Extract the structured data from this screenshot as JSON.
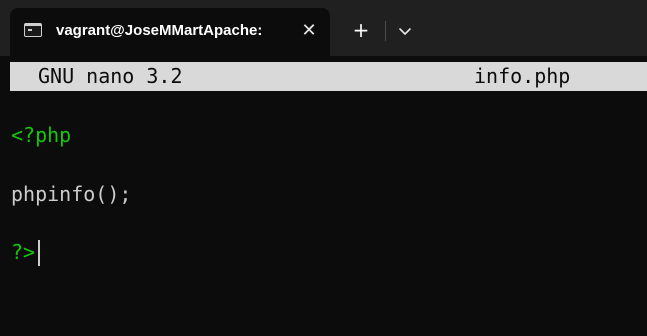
{
  "tab": {
    "title": "vagrant@JoseMMartApache: ",
    "icon": "terminal-icon",
    "close_icon": "close-icon"
  },
  "tabbar": {
    "new_tab_label": "+",
    "dropdown_icon": "chevron-down-icon"
  },
  "editor": {
    "name_version": "GNU nano 3.2",
    "filename": "info.php",
    "lines": [
      "<?php",
      "phpinfo();",
      "?>"
    ]
  },
  "colors": {
    "background": "#0c0c0c",
    "tabbar": "#202020",
    "header_bar": "#d9d9d9",
    "php_tag": "#16c60c",
    "text": "#cccccc"
  }
}
